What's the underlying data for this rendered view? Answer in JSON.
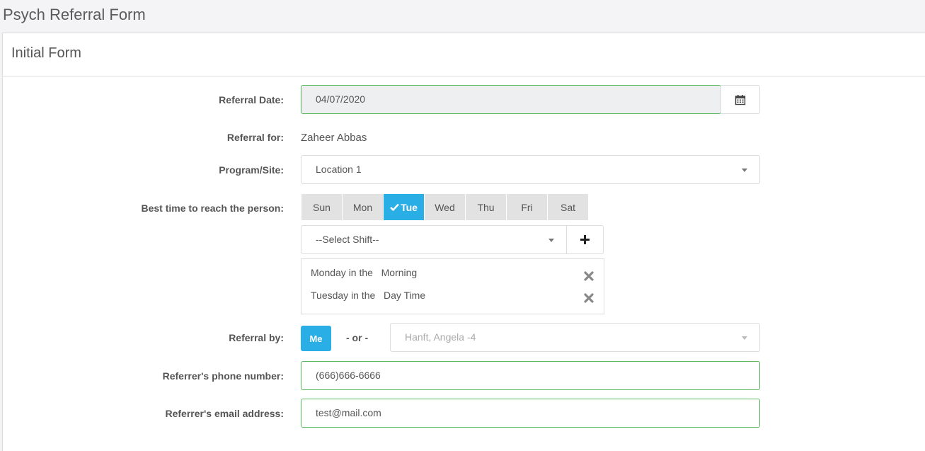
{
  "page": {
    "title": "Psych Referral Form"
  },
  "panel": {
    "title": "Initial Form"
  },
  "form": {
    "referral_date": {
      "label": "Referral Date:",
      "value": "04/07/2020",
      "icon": "calendar-icon"
    },
    "referral_for": {
      "label": "Referral for:",
      "value": "Zaheer Abbas"
    },
    "program_site": {
      "label": "Program/Site:",
      "value": "Location 1"
    },
    "best_time": {
      "label": "Best time to reach the person:",
      "days": [
        "Sun",
        "Mon",
        "Tue",
        "Wed",
        "Thu",
        "Fri",
        "Sat"
      ],
      "active_day": "Tue",
      "shift_placeholder": "--Select Shift--",
      "entries": [
        {
          "day_text": "Monday in the",
          "shift": "Morning"
        },
        {
          "day_text": "Tuesday in the",
          "shift": "Day Time"
        }
      ]
    },
    "referral_by": {
      "label": "Referral by:",
      "me_label": "Me",
      "or_text": "- or -",
      "selected": "Hanft, Angela -4"
    },
    "phone": {
      "label": "Referrer's phone number:",
      "value": "(666)666-6666"
    },
    "email": {
      "label": "Referrer's email address:",
      "value": "test@mail.com"
    }
  },
  "colors": {
    "accent": "#29aee6",
    "valid_border": "#5cb85c"
  }
}
